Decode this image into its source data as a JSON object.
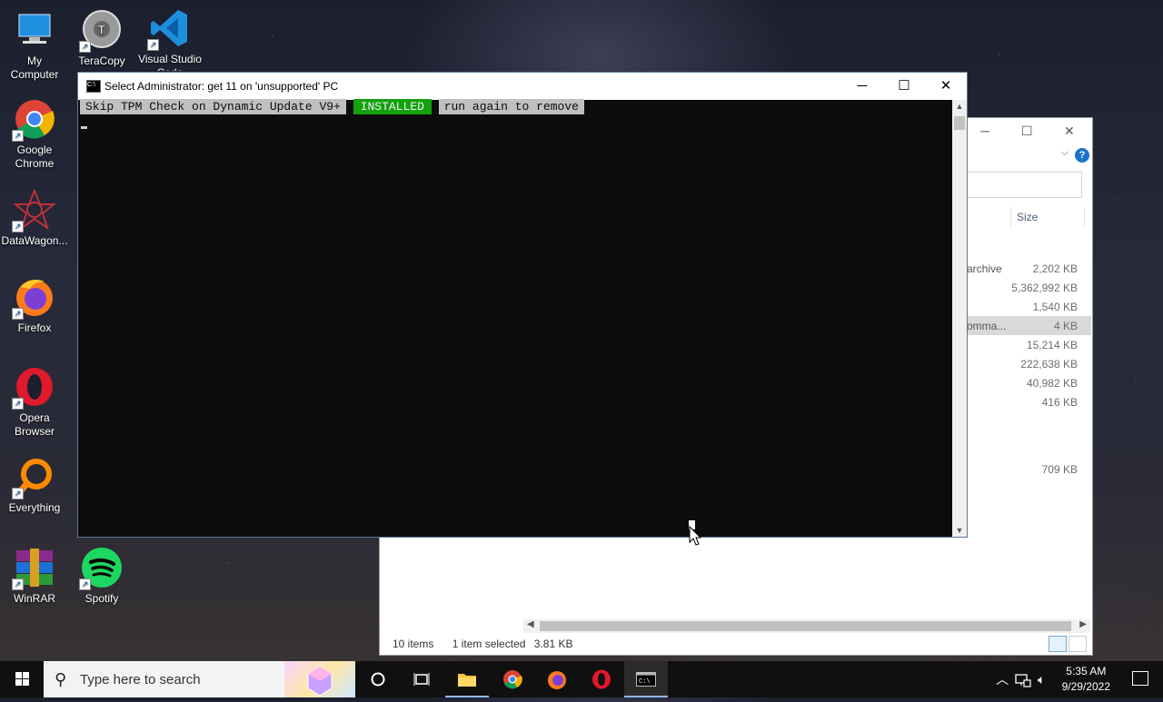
{
  "desktop_icons": {
    "my_computer": "My\nComputer",
    "teracopy": "TeraCopy",
    "vscode": "Visual Studio Code",
    "chrome": "Google\nChrome",
    "datawagon": "DataWagon...",
    "firefox": "Firefox",
    "opera": "Opera\nBrowser",
    "everything": "Everything",
    "winrar": "WinRAR",
    "spotify": "Spotify"
  },
  "console": {
    "title": "Select Administrator:  get 11 on 'unsupported' PC",
    "line_part1": "Skip TPM Check on Dynamic Update V9+",
    "line_part2": "INSTALLED",
    "line_part3": "run again to remove",
    "minimize": "─",
    "maximize": "☐",
    "close": "✕"
  },
  "explorer": {
    "col_size": "Size",
    "rows": [
      {
        "type": "archive",
        "size": "2,202 KB"
      },
      {
        "type": "",
        "size": "5,362,992 KB"
      },
      {
        "type": "",
        "size": "1,540 KB"
      },
      {
        "type": "omma...",
        "size": "4 KB",
        "selected": true
      },
      {
        "type": "",
        "size": "15,214 KB"
      },
      {
        "type": "",
        "size": "222,638 KB"
      },
      {
        "type": "",
        "size": "40,982 KB"
      },
      {
        "type": "",
        "size": "416 KB"
      },
      {
        "type": "",
        "size": "709 KB"
      }
    ],
    "status_items": "10 items",
    "status_selected": "1 item selected",
    "status_size": "3.81 KB",
    "help": "?"
  },
  "taskbar": {
    "search_placeholder": "Type here to search",
    "time": "5:35 AM",
    "date": "9/29/2022"
  }
}
